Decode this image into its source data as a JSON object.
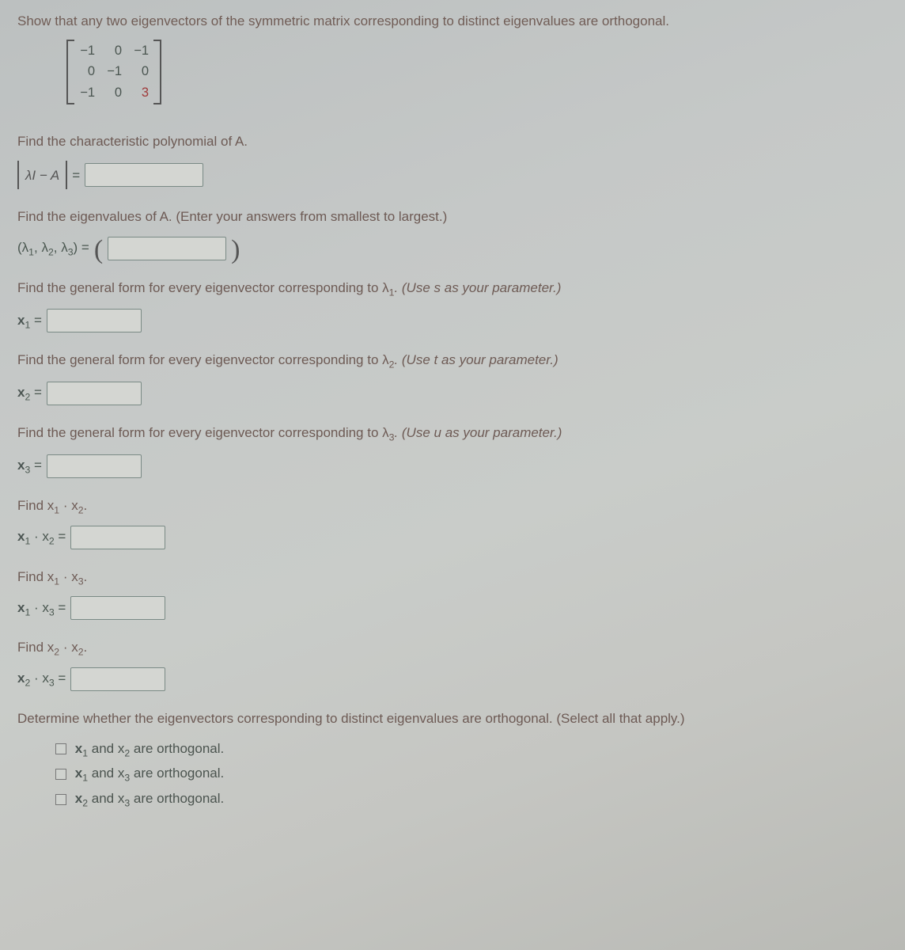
{
  "intro": "Show that any two eigenvectors of the symmetric matrix corresponding to distinct eigenvalues are orthogonal.",
  "matrix": {
    "r1c1": "−1",
    "r1c2": "0",
    "r1c3": "−1",
    "r2c1": "0",
    "r2c2": "−1",
    "r2c3": "0",
    "r3c1": "−1",
    "r3c2": "0",
    "r3c3": "3"
  },
  "chart_data": {
    "type": "table",
    "title": "Symmetric matrix A",
    "rows": [
      [
        -1,
        0,
        -1
      ],
      [
        0,
        -1,
        0
      ],
      [
        -1,
        0,
        3
      ]
    ]
  },
  "p_charpoly": "Find the characteristic polynomial of A.",
  "det_label": "λI − A",
  "eq": "=",
  "p_eigval": "Find the eigenvalues of A. (Enter your answers from smallest to largest.)",
  "eigtuple_left": "(λ",
  "comma": ", ",
  "lam": "λ",
  "close_paren_eq": ") =",
  "ev1": {
    "prompt_a": "Find the general form for every eigenvector corresponding to  λ",
    "prompt_b": ".  (Use s as your parameter.)",
    "label": "x",
    "sub": "1",
    "eq": " ="
  },
  "ev2": {
    "prompt_a": "Find the general form for every eigenvector corresponding to  λ",
    "prompt_b": ".  (Use t as your parameter.)",
    "label": "x",
    "sub": "2",
    "eq": " ="
  },
  "ev3": {
    "prompt_a": "Find the general form for every eigenvector corresponding to  λ",
    "prompt_b": ".  (Use u as your parameter.)",
    "label": "x",
    "sub": "3",
    "eq": " ="
  },
  "d12": {
    "find": "Find  x",
    "s1": "1",
    "dot": " · x",
    "s2": "2",
    "period": ".",
    "lhs": "x",
    "eq": " ="
  },
  "d13": {
    "find": "Find  x",
    "s1": "1",
    "dot": " · x",
    "s2": "3",
    "period": ".",
    "lhs": "x",
    "eq": " ="
  },
  "d23": {
    "find": "Find  x",
    "s1": "2",
    "dot": " · x",
    "s2": "2",
    "period": ".",
    "lhs_s1": "2",
    "lhs_s2": "3",
    "lhs": "x",
    "eq": " ="
  },
  "determine": "Determine whether the eigenvectors corresponding to distinct eigenvalues are orthogonal. (Select all that apply.)",
  "opts": {
    "o1a": "x",
    "o1s1": "1",
    "o1mid": " and x",
    "o1s2": "2",
    "o1end": " are orthogonal.",
    "o2a": "x",
    "o2s1": "1",
    "o2mid": " and x",
    "o2s2": "3",
    "o2end": " are orthogonal.",
    "o3a": "x",
    "o3s1": "2",
    "o3mid": " and x",
    "o3s2": "3",
    "o3end": " are orthogonal."
  }
}
